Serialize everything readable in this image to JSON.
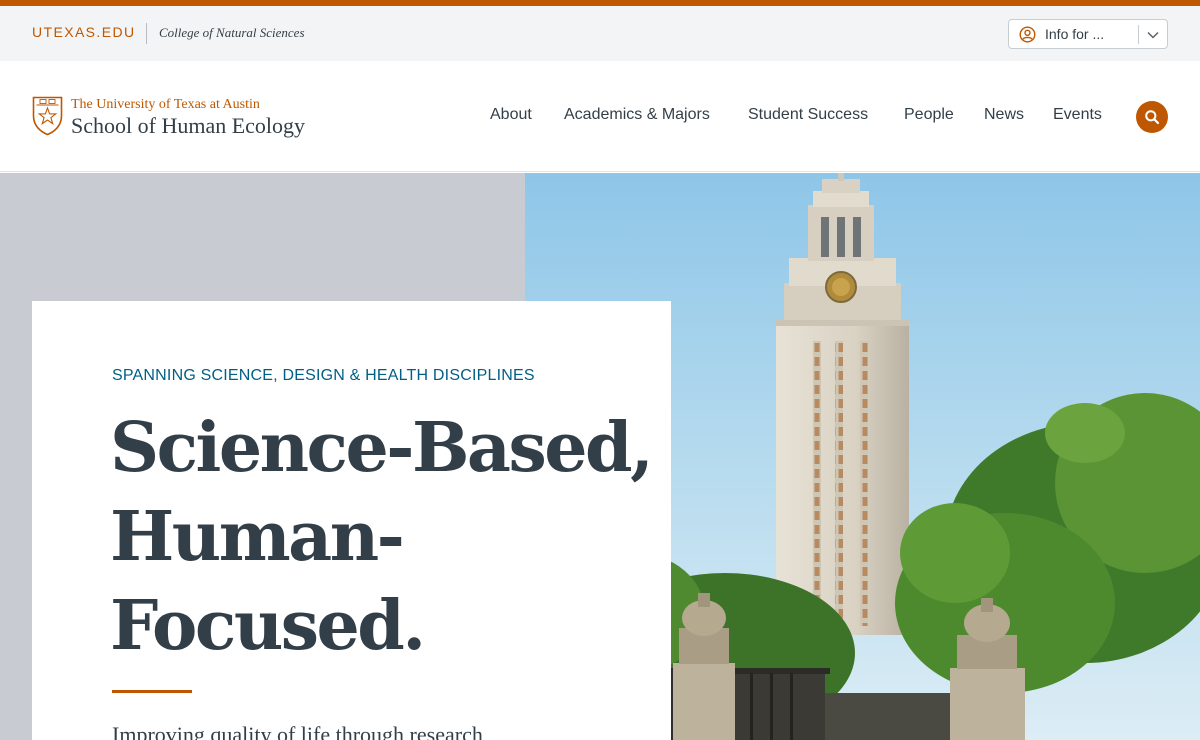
{
  "utility_bar": {
    "utexas_label": "UTEXAS.EDU",
    "college_label": "College of Natural Sciences",
    "info_dropdown": {
      "label": "Info for ..."
    }
  },
  "header": {
    "logo_university": "The University of Texas at Austin",
    "logo_school": "School of Human Ecology",
    "nav": [
      "About",
      "Academics & Majors",
      "Student Success",
      "People",
      "News",
      "Events"
    ]
  },
  "hero": {
    "eyebrow": "SPANNING SCIENCE, DESIGN & HEALTH DISCIPLINES",
    "headline_lines": [
      "Science-Based,",
      "Human-",
      "Focused."
    ],
    "lead": "Improving quality of life through research"
  },
  "icons": {
    "info_dropdown": "user-circle-icon",
    "dropdown_toggle": "chevron-down-icon",
    "search": "search-icon",
    "logo": "ut-seal-icon"
  },
  "colors": {
    "burnt_orange": "#bf5700",
    "charcoal": "#333f48",
    "teal": "#005f86",
    "utility_bg": "#f3f4f5",
    "hero_gray": "#c8ccd2"
  }
}
